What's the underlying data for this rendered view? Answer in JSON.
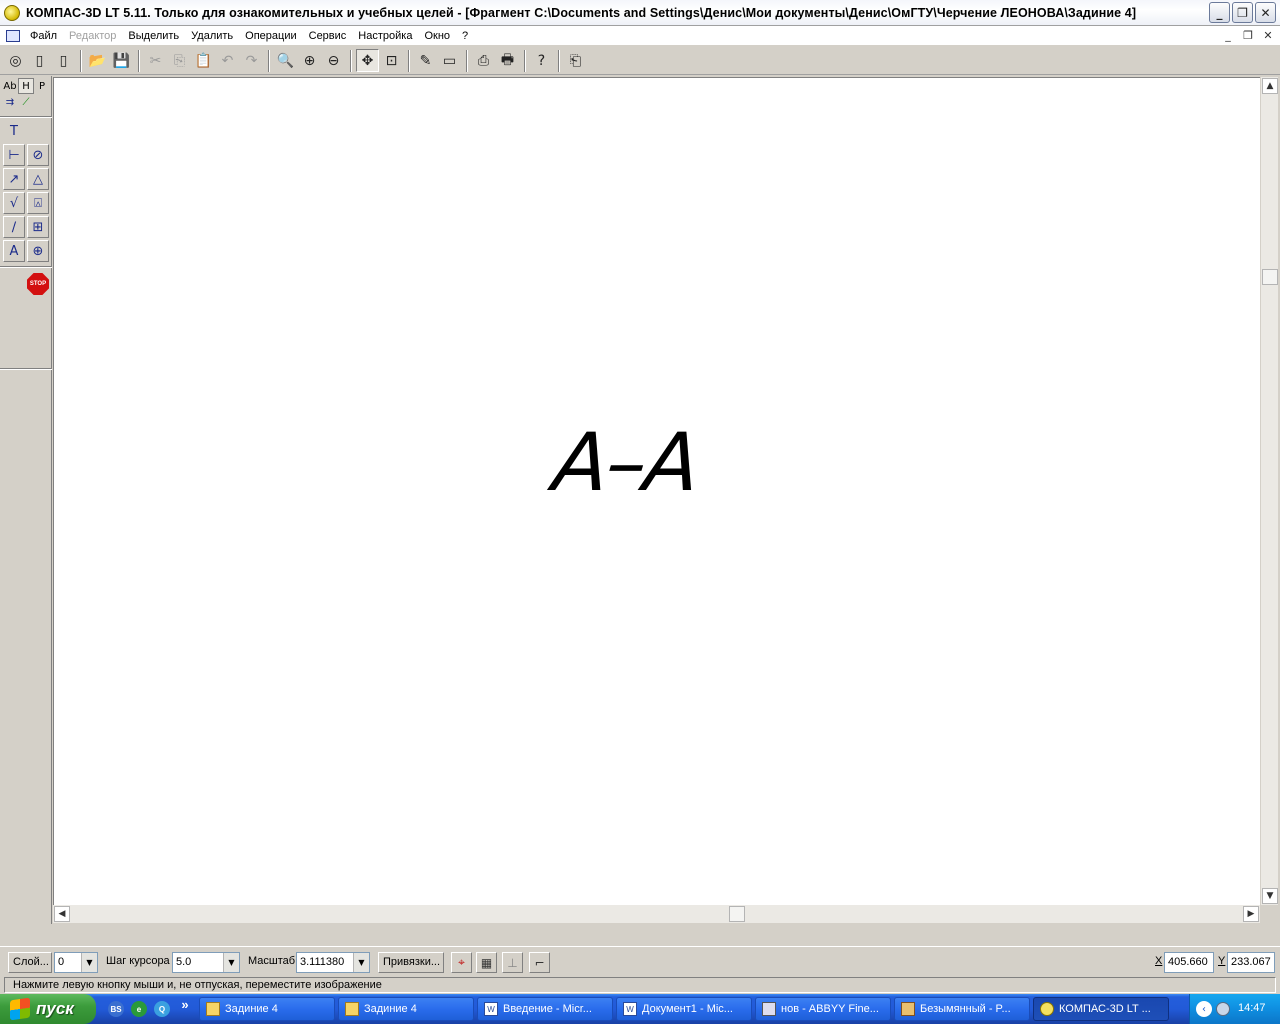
{
  "window": {
    "title": "КОМПАС-3D LT 5.11. Только для ознакомительных и учебных целей - [Фрагмент C:\\Documents and Settings\\Денис\\Мои документы\\Денис\\ОмГТУ\\Черчение ЛЕОНОВА\\Задиние 4]",
    "minimize": "_",
    "restore": "❐",
    "close": "✕"
  },
  "menu": {
    "items": [
      {
        "label": "Файл",
        "disabled": false
      },
      {
        "label": "Редактор",
        "disabled": true
      },
      {
        "label": "Выделить",
        "disabled": false
      },
      {
        "label": "Удалить",
        "disabled": false
      },
      {
        "label": "Операции",
        "disabled": false
      },
      {
        "label": "Сервис",
        "disabled": false
      },
      {
        "label": "Настройка",
        "disabled": false
      },
      {
        "label": "Окно",
        "disabled": false
      },
      {
        "label": "?",
        "disabled": false
      }
    ],
    "mdi_minimize": "_",
    "mdi_restore": "❐",
    "mdi_close": "✕"
  },
  "toolbar": {
    "icons": [
      "◎",
      "▯",
      "▯",
      "📂",
      "💾",
      "✂",
      "⎘",
      "📋",
      "↶",
      "↷",
      "🔍",
      "⊕",
      "⊖",
      "✥",
      "⊡",
      "✎",
      "▭",
      "⎙",
      "🖶",
      "?",
      "⎗"
    ]
  },
  "left_panel": {
    "tab_labels": [
      "Ab",
      "H",
      "P"
    ],
    "tool_icons": [
      "T",
      "⊢",
      "⊘",
      "↗",
      "△",
      "√",
      "⍓",
      "∕",
      "⊞",
      "A",
      "⊕"
    ],
    "stop_label": "STOP"
  },
  "drawing": {
    "text": "А–А"
  },
  "bottom_panel": {
    "layer_button": "Слой...",
    "layer_value": "0",
    "cursor_step_label": "Шаг курсора",
    "cursor_step_value": "5.0",
    "scale_label": "Масштаб",
    "scale_value": "3.111380",
    "snaps_button": "Привязки...",
    "x_label": "X",
    "x_value": "405.660",
    "y_label": "Y",
    "y_value": "233.067"
  },
  "status": {
    "text": "Нажмите левую кнопку мыши и, не отпуская, переместите изображение"
  },
  "taskbar": {
    "start_label": "пуск",
    "quick_launch": [
      "BS",
      "e",
      "Q"
    ],
    "overflow": "»",
    "tasks": [
      {
        "label": "Задиние 4",
        "active": false
      },
      {
        "label": "Задиние 4",
        "active": false
      },
      {
        "label": "Введение - Micr...",
        "active": false
      },
      {
        "label": "Документ1 - Mic...",
        "active": false
      },
      {
        "label": "нов - ABBYY Fine...",
        "active": false
      },
      {
        "label": "Безымянный - P...",
        "active": false
      },
      {
        "label": "КОМПАС-3D LT ...",
        "active": true
      }
    ],
    "tray_arrow": "‹",
    "time": "14:47"
  }
}
